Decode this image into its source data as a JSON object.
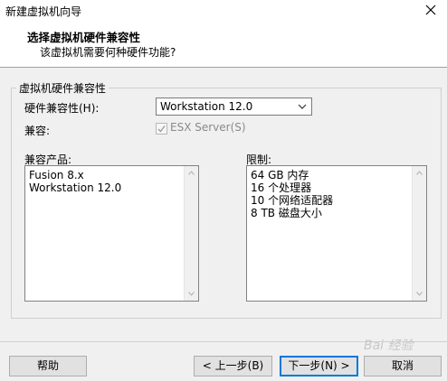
{
  "window": {
    "title": "新建虚拟机向导"
  },
  "header": {
    "title": "选择虚拟机硬件兼容性",
    "subtitle": "该虚拟机需要何种硬件功能?"
  },
  "group": {
    "title": "虚拟机硬件兼容性",
    "hw_label": "硬件兼容性(H):",
    "hw_value": "Workstation 12.0",
    "compat_label": "兼容:",
    "esx_label": "ESX Server(S)",
    "esx_checked": true
  },
  "products": {
    "label": "兼容产品:",
    "items": [
      "Fusion 8.x",
      "Workstation 12.0"
    ]
  },
  "limits": {
    "label": "限制:",
    "items": [
      "64 GB 内存",
      "16 个处理器",
      "10 个网络适配器",
      "8 TB 磁盘大小"
    ]
  },
  "buttons": {
    "help": "帮助",
    "back": "< 上一步(B)",
    "next": "下一步(N) >",
    "cancel": "取消"
  },
  "watermark": "Bai 经验"
}
